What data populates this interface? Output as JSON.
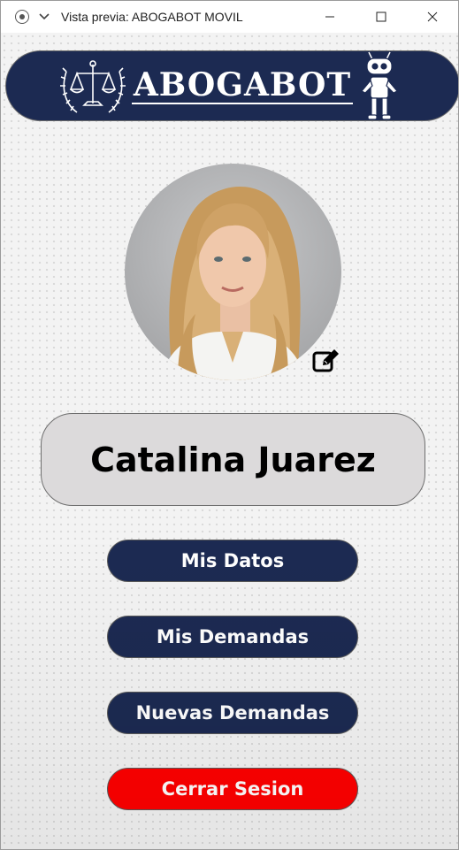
{
  "window": {
    "title": "Vista previa: ABOGABOT MOVIL"
  },
  "banner": {
    "brand": "ABOGABOT"
  },
  "profile": {
    "name": "Catalina Juarez"
  },
  "menu": {
    "mis_datos": "Mis Datos",
    "mis_demandas": "Mis Demandas",
    "nuevas_demandas": "Nuevas Demandas",
    "cerrar_sesion": "Cerrar Sesion"
  },
  "colors": {
    "navy": "#1c2a52",
    "danger": "#ff0000",
    "name_box": "#dcdadb"
  }
}
